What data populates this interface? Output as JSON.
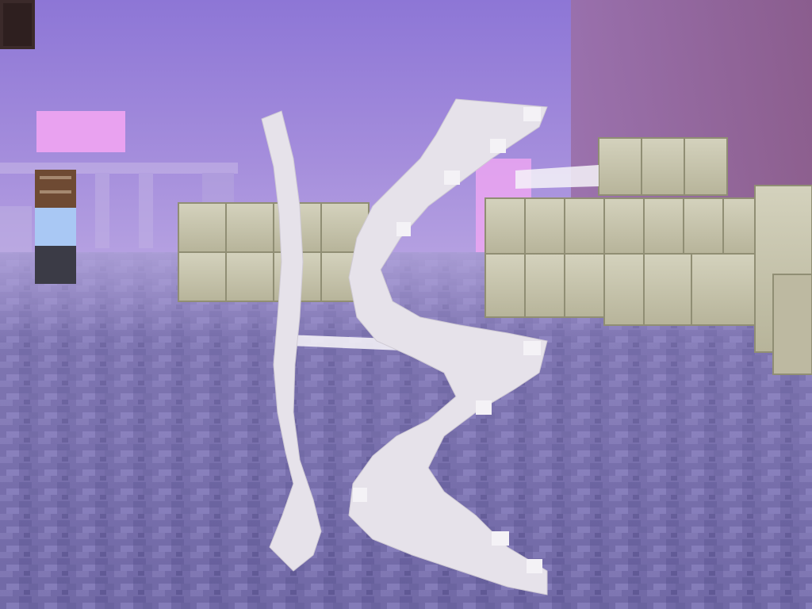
{
  "scene": {
    "type": "first-person-3d-voxel-game-view",
    "sky_color": "#9a80d8",
    "floor_color": "#7068a8",
    "block_color": "#c9c6ae",
    "bow_color": "#e8e4ea",
    "hud": {
      "visible_text": []
    }
  }
}
